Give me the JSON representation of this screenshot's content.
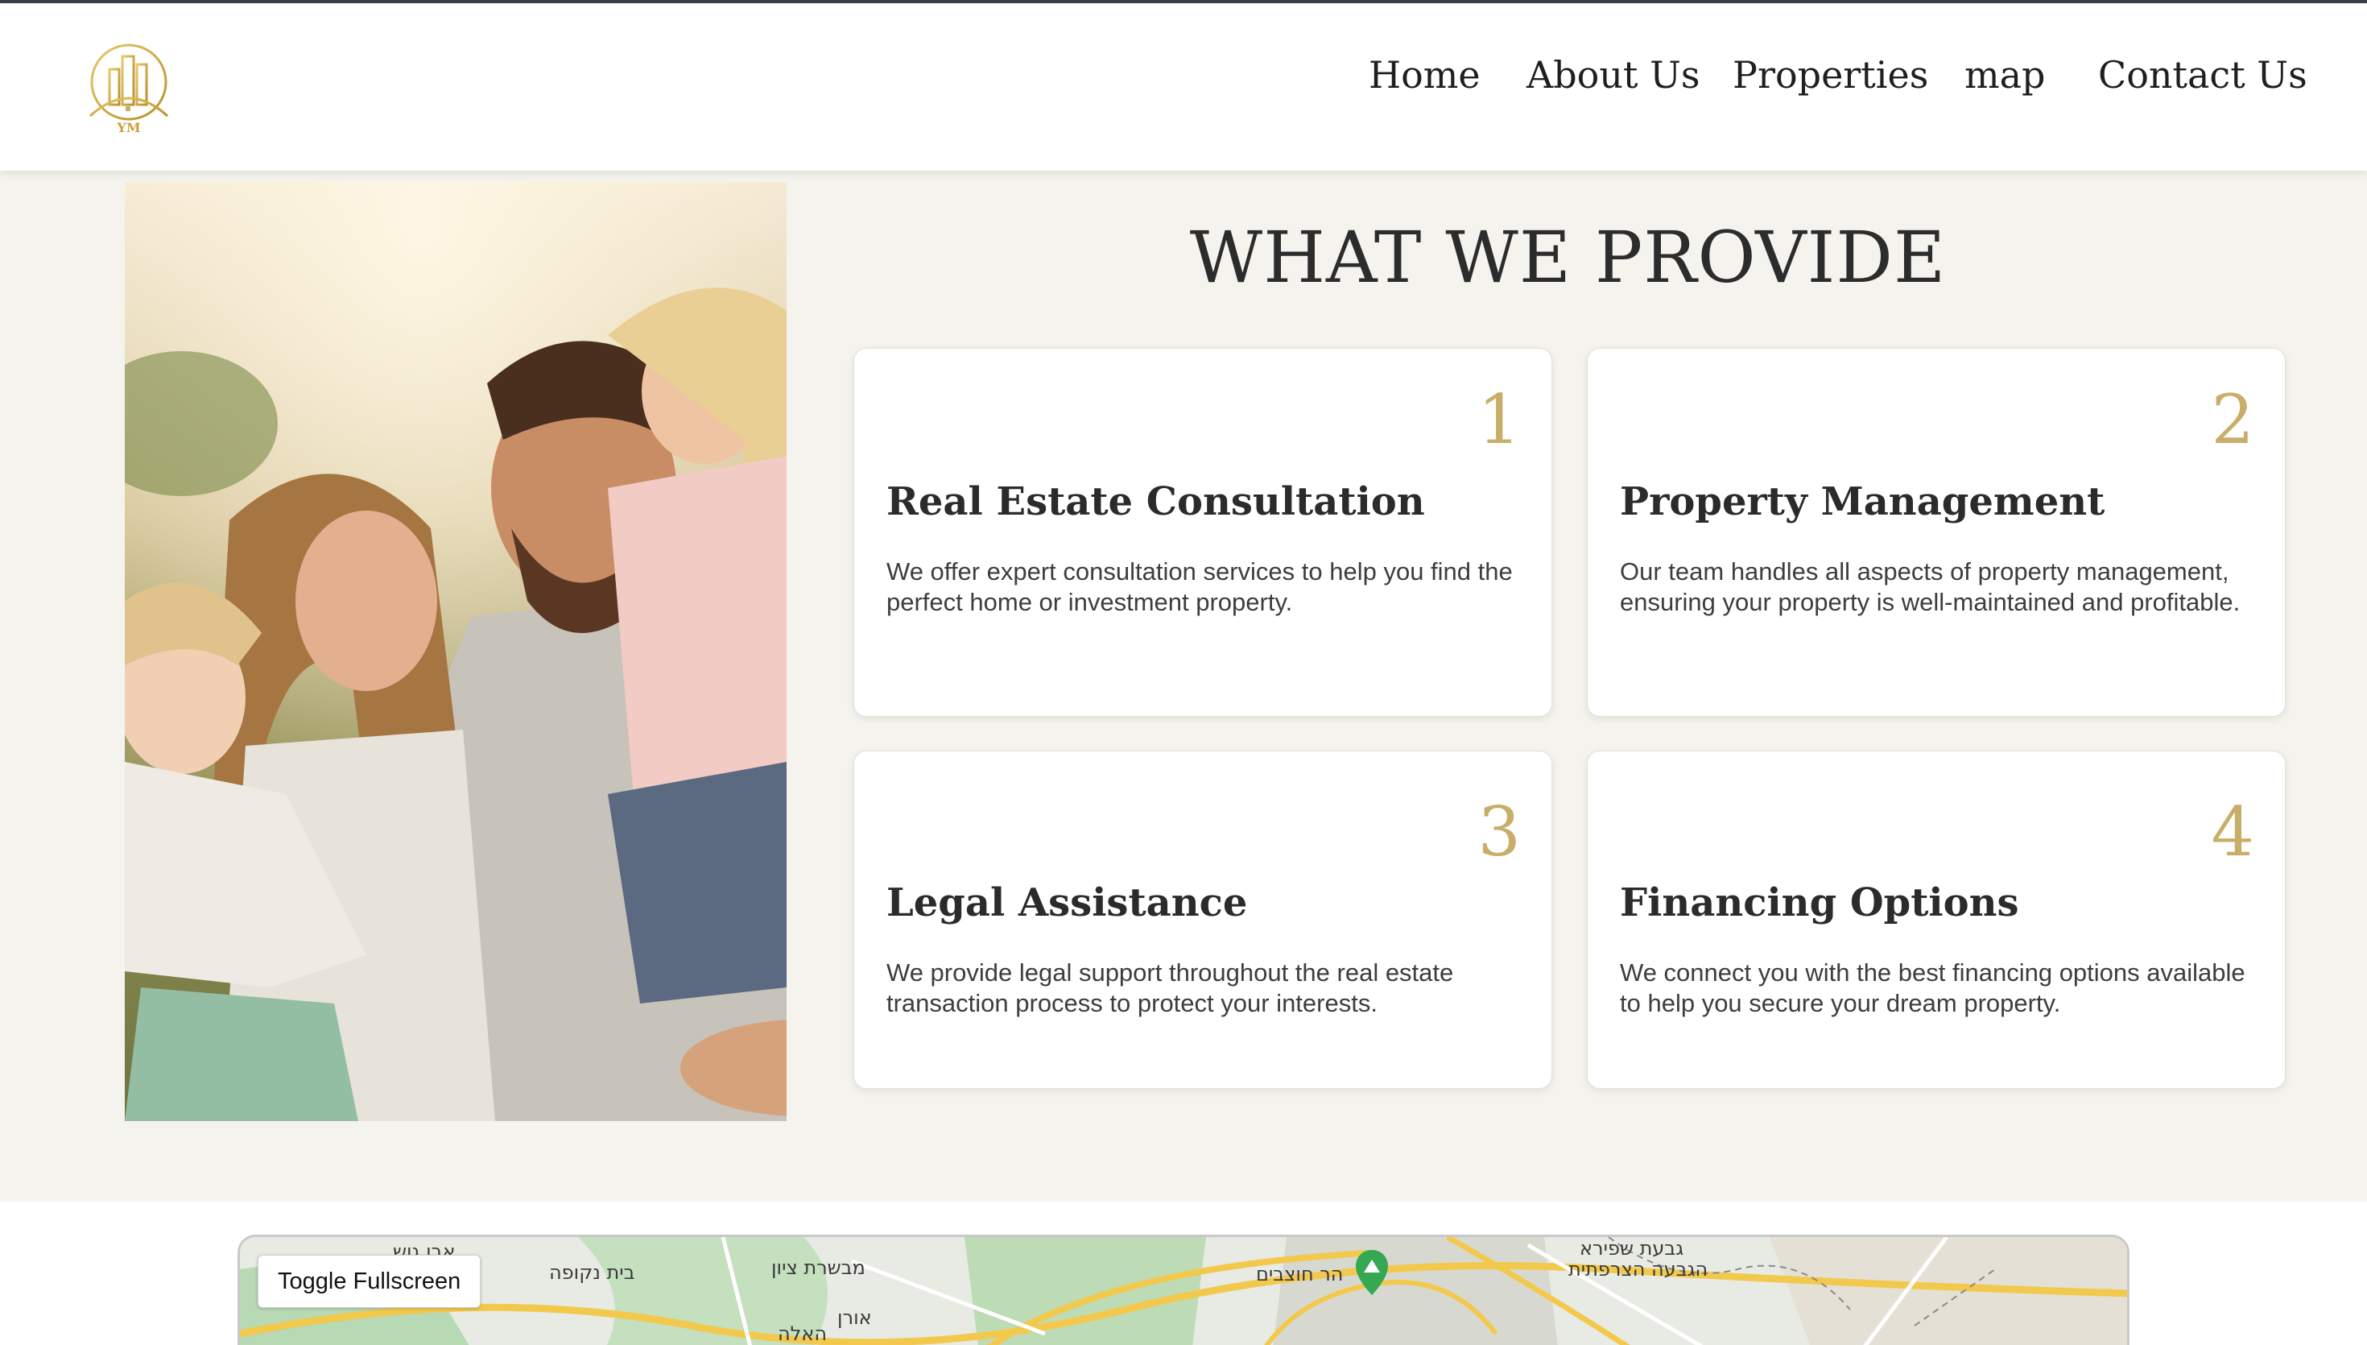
{
  "header": {
    "logo_text": "YM",
    "nav": [
      "Home",
      "About Us",
      "Properties",
      "map",
      "Contact Us"
    ]
  },
  "services": {
    "title": "WHAT WE PROVIDE",
    "cards": [
      {
        "number": "1",
        "title": "Real Estate Consultation",
        "text": "We offer expert consultation services to help you find the perfect home or investment property."
      },
      {
        "number": "2",
        "title": "Property Management",
        "text": "Our team handles all aspects of property management, ensuring your property is well-maintained and profitable."
      },
      {
        "number": "3",
        "title": "Legal Assistance",
        "text": "We provide legal support throughout the real estate transaction process to protect your interests."
      },
      {
        "number": "4",
        "title": "Financing Options",
        "text": "We connect you with the best financing options available to help you secure your dream property."
      }
    ]
  },
  "map": {
    "toggle_label": "Toggle Fullscreen",
    "labels": [
      "בית נקופה",
      "מבשרת ציון",
      "הר חוצבים",
      "גבעת שפירא",
      "הגבעה הצרפתית",
      "אבו גוש",
      "אורן",
      "האלה"
    ]
  },
  "colors": {
    "accent_gold": "#c9ae6a",
    "section_bg": "#f5f3ee",
    "map_pin": "#34a853"
  }
}
